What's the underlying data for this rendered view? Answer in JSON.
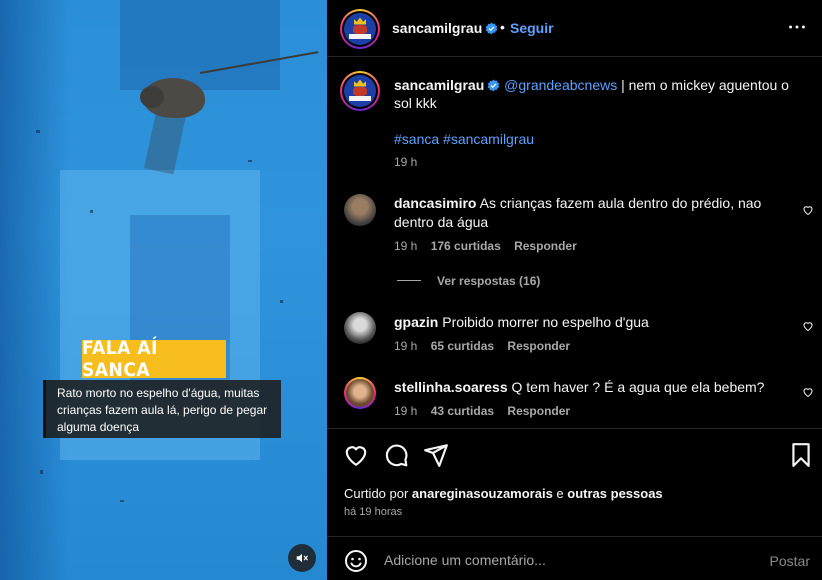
{
  "media": {
    "overlay_tag": "FALA AÍ SANCA",
    "caption": "Rato morto no espelho d'água, muitas crianças fazem aula lá, perigo de pegar alguma doença",
    "mute_icon": "speaker-muted-icon"
  },
  "header": {
    "username": "sancamilgrau",
    "separator": "•",
    "follow_label": "Seguir",
    "more_icon": "more-horizontal-icon"
  },
  "post": {
    "username": "sancamilgrau",
    "mention": "@grandeabcnews",
    "text": " | nem o mickey aguentou o sol kkk",
    "hashtags": "#sanca #sancamilgrau",
    "time": "19 h"
  },
  "comments": [
    {
      "username": "dancasimiro",
      "text": "As crianças fazem aula dentro do prédio, nao dentro da água",
      "time": "19 h",
      "likes": "176 curtidas",
      "reply_label": "Responder"
    },
    {
      "username": "gpazin",
      "text": "Proibido morrer no espelho d'gua",
      "time": "19 h",
      "likes": "65 curtidas",
      "reply_label": "Responder"
    },
    {
      "username": "stellinha.soaress",
      "text": "Q tem haver ? É a agua que ela bebem?",
      "time": "19 h",
      "likes": "43 curtidas",
      "reply_label": "Responder"
    }
  ],
  "view_replies": "Ver respostas (16)",
  "actions": {
    "like_icon": "heart-icon",
    "comment_icon": "comment-icon",
    "share_icon": "send-icon",
    "save_icon": "bookmark-icon"
  },
  "likes_line": {
    "prefix": "Curtido por ",
    "user": "anareginasouzamorais",
    "middle": " e ",
    "others": "outras pessoas"
  },
  "posted_ago": "há 19 horas",
  "composer": {
    "placeholder": "Adicione um comentário...",
    "post_label": "Postar",
    "emoji_icon": "emoji-icon"
  },
  "colors": {
    "accent": "#5ea1ff",
    "tag": "#f6bd1d",
    "water": "#2f94dc"
  }
}
